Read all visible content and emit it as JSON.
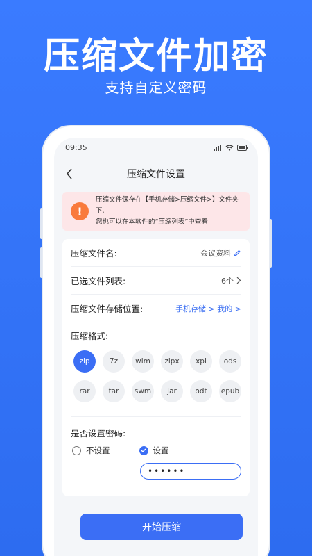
{
  "promo": {
    "title": "压缩文件加密",
    "subtitle": "支持自定义密码"
  },
  "status_bar": {
    "time": "09:35",
    "icons": [
      "signal-icon",
      "wifi-icon",
      "battery-icon"
    ]
  },
  "nav": {
    "title": "压缩文件设置",
    "back_icon": "chevron-left-icon"
  },
  "notice": {
    "icon": "exclamation-icon",
    "line1": "压缩文件保存在【手机存储>压缩文件>】文件夹下,",
    "line2": "您也可以在本软件的“压缩列表”中查看",
    "color": "#fde6e8"
  },
  "settings": {
    "file_name_label": "压缩文件名:",
    "file_name_value": "会议资料",
    "selected_label": "已选文件列表:",
    "selected_value": "6个",
    "location_label": "压缩文件存储位置:",
    "location_value": "手机存储 > 我的 >",
    "format_label": "压缩格式:",
    "formats": [
      "zip",
      "7z",
      "wim",
      "zipx",
      "xpi",
      "ods",
      "rar",
      "tar",
      "swm",
      "jar",
      "odt",
      "epub"
    ],
    "selected_format": "zip",
    "password_label": "是否设置密码:",
    "password_off": "不设置",
    "password_on": "设置",
    "password_mode": "设置",
    "password_value": "••••••"
  },
  "action": {
    "start_label": "开始压缩"
  },
  "colors": {
    "accent": "#3b6ef5",
    "background": "#2f6ff5",
    "warning": "#f97a3c"
  }
}
